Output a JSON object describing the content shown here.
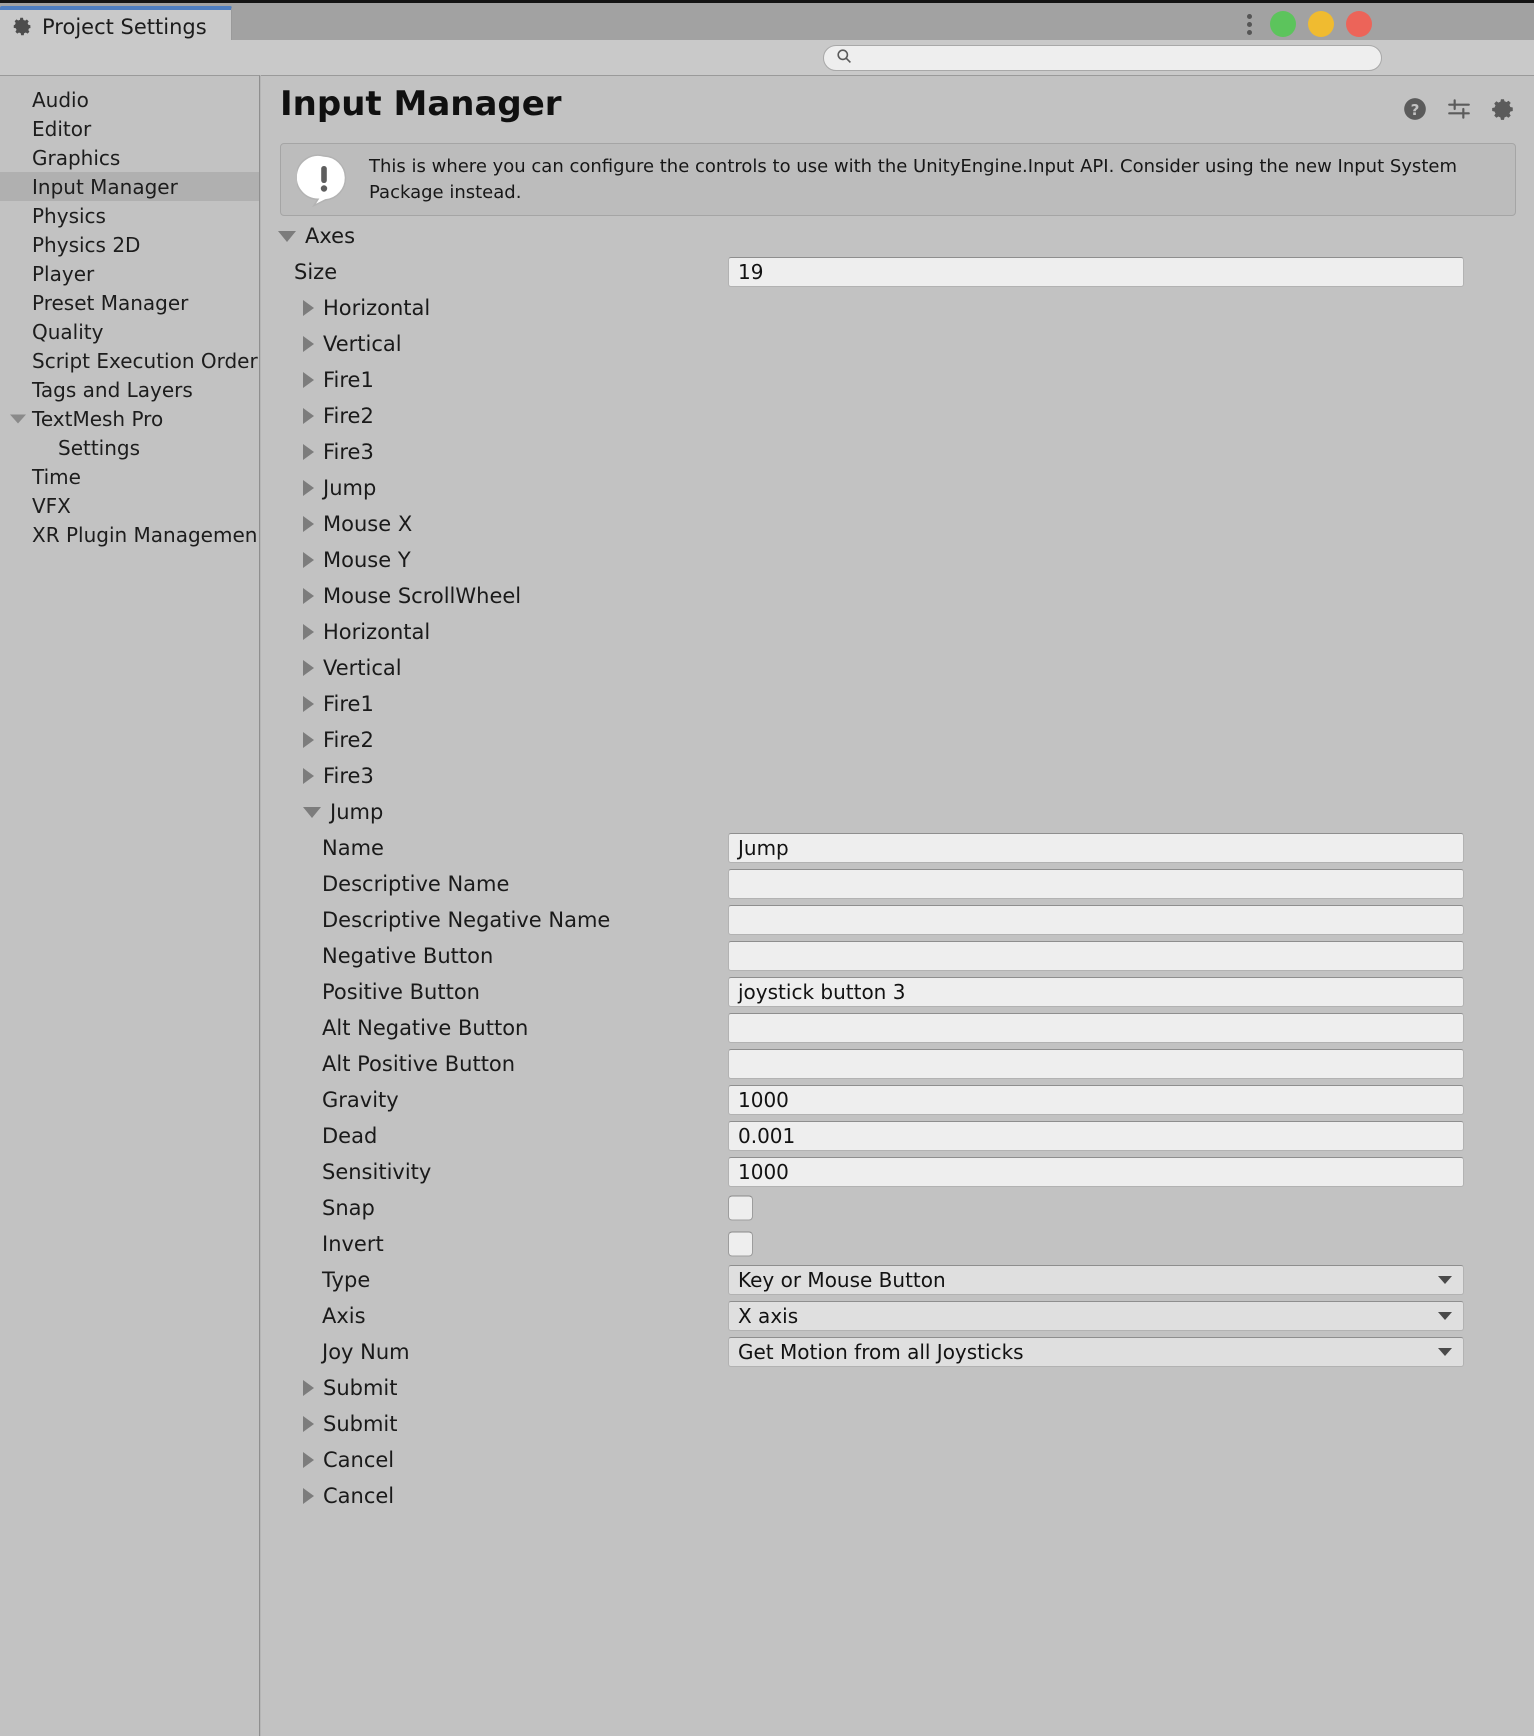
{
  "window": {
    "tab_label": "Project Settings",
    "tab_icon": "gear-icon",
    "menu_icon": "kebab-menu-icon",
    "buttons": {
      "minimize": "minimize-button",
      "maximize": "maximize-button",
      "close": "close-button"
    },
    "colors": {
      "minimize": "#5cc45c",
      "maximize": "#f0bb30",
      "close": "#ec6459",
      "tab_accent": "#4e7ec1"
    }
  },
  "search": {
    "value": "",
    "placeholder": "",
    "icon": "search-icon"
  },
  "sidebar": {
    "items": [
      {
        "label": "Audio",
        "level": 0,
        "selected": false,
        "expander": ""
      },
      {
        "label": "Editor",
        "level": 0,
        "selected": false,
        "expander": ""
      },
      {
        "label": "Graphics",
        "level": 0,
        "selected": false,
        "expander": ""
      },
      {
        "label": "Input Manager",
        "level": 0,
        "selected": true,
        "expander": ""
      },
      {
        "label": "Physics",
        "level": 0,
        "selected": false,
        "expander": ""
      },
      {
        "label": "Physics 2D",
        "level": 0,
        "selected": false,
        "expander": ""
      },
      {
        "label": "Player",
        "level": 0,
        "selected": false,
        "expander": ""
      },
      {
        "label": "Preset Manager",
        "level": 0,
        "selected": false,
        "expander": ""
      },
      {
        "label": "Quality",
        "level": 0,
        "selected": false,
        "expander": ""
      },
      {
        "label": "Script Execution Order",
        "level": 0,
        "selected": false,
        "expander": ""
      },
      {
        "label": "Tags and Layers",
        "level": 0,
        "selected": false,
        "expander": ""
      },
      {
        "label": "TextMesh Pro",
        "level": 0,
        "selected": false,
        "expander": "expanded"
      },
      {
        "label": "Settings",
        "level": 1,
        "selected": false,
        "expander": ""
      },
      {
        "label": "Time",
        "level": 0,
        "selected": false,
        "expander": ""
      },
      {
        "label": "VFX",
        "level": 0,
        "selected": false,
        "expander": ""
      },
      {
        "label": "XR Plugin Managemen",
        "level": 0,
        "selected": false,
        "expander": ""
      }
    ]
  },
  "main": {
    "title": "Input Manager",
    "header_icons": [
      {
        "name": "help-icon"
      },
      {
        "name": "preset-icon"
      },
      {
        "name": "settings-gear-icon"
      }
    ],
    "info": {
      "icon": "info-bubble-icon",
      "text": "This is where you can configure the controls to use with the UnityEngine.Input API. Consider using the new Input System Package instead."
    },
    "rows": [
      {
        "kind": "tree",
        "label": "Axes",
        "level": 0,
        "expander": "expanded"
      },
      {
        "kind": "text",
        "label": "Size",
        "level": 1,
        "value": "19"
      },
      {
        "kind": "tree",
        "label": "Horizontal",
        "level": 2,
        "expander": "collapsed"
      },
      {
        "kind": "tree",
        "label": "Vertical",
        "level": 2,
        "expander": "collapsed"
      },
      {
        "kind": "tree",
        "label": "Fire1",
        "level": 2,
        "expander": "collapsed"
      },
      {
        "kind": "tree",
        "label": "Fire2",
        "level": 2,
        "expander": "collapsed"
      },
      {
        "kind": "tree",
        "label": "Fire3",
        "level": 2,
        "expander": "collapsed"
      },
      {
        "kind": "tree",
        "label": "Jump",
        "level": 2,
        "expander": "collapsed"
      },
      {
        "kind": "tree",
        "label": "Mouse X",
        "level": 2,
        "expander": "collapsed"
      },
      {
        "kind": "tree",
        "label": "Mouse Y",
        "level": 2,
        "expander": "collapsed"
      },
      {
        "kind": "tree",
        "label": "Mouse ScrollWheel",
        "level": 2,
        "expander": "collapsed"
      },
      {
        "kind": "tree",
        "label": "Horizontal",
        "level": 2,
        "expander": "collapsed"
      },
      {
        "kind": "tree",
        "label": "Vertical",
        "level": 2,
        "expander": "collapsed"
      },
      {
        "kind": "tree",
        "label": "Fire1",
        "level": 2,
        "expander": "collapsed"
      },
      {
        "kind": "tree",
        "label": "Fire2",
        "level": 2,
        "expander": "collapsed"
      },
      {
        "kind": "tree",
        "label": "Fire3",
        "level": 2,
        "expander": "collapsed"
      },
      {
        "kind": "tree",
        "label": "Jump",
        "level": 2,
        "expander": "expanded"
      },
      {
        "kind": "text",
        "label": "Name",
        "level": 3,
        "value": "Jump"
      },
      {
        "kind": "text",
        "label": "Descriptive Name",
        "level": 3,
        "value": ""
      },
      {
        "kind": "text",
        "label": "Descriptive Negative Name",
        "level": 3,
        "value": ""
      },
      {
        "kind": "text",
        "label": "Negative Button",
        "level": 3,
        "value": ""
      },
      {
        "kind": "text",
        "label": "Positive Button",
        "level": 3,
        "value": "joystick button 3"
      },
      {
        "kind": "text",
        "label": "Alt Negative Button",
        "level": 3,
        "value": ""
      },
      {
        "kind": "text",
        "label": "Alt Positive Button",
        "level": 3,
        "value": ""
      },
      {
        "kind": "text",
        "label": "Gravity",
        "level": 3,
        "value": "1000"
      },
      {
        "kind": "text",
        "label": "Dead",
        "level": 3,
        "value": "0.001"
      },
      {
        "kind": "text",
        "label": "Sensitivity",
        "level": 3,
        "value": "1000"
      },
      {
        "kind": "checkbox",
        "label": "Snap",
        "level": 3,
        "checked": false
      },
      {
        "kind": "checkbox",
        "label": "Invert",
        "level": 3,
        "checked": false
      },
      {
        "kind": "dropdown",
        "label": "Type",
        "level": 3,
        "value": "Key or Mouse Button"
      },
      {
        "kind": "dropdown",
        "label": "Axis",
        "level": 3,
        "value": "X axis"
      },
      {
        "kind": "dropdown",
        "label": "Joy Num",
        "level": 3,
        "value": "Get Motion from all Joysticks"
      },
      {
        "kind": "tree",
        "label": "Submit",
        "level": 2,
        "expander": "collapsed"
      },
      {
        "kind": "tree",
        "label": "Submit",
        "level": 2,
        "expander": "collapsed"
      },
      {
        "kind": "tree",
        "label": "Cancel",
        "level": 2,
        "expander": "collapsed"
      },
      {
        "kind": "tree",
        "label": "Cancel",
        "level": 2,
        "expander": "collapsed"
      }
    ]
  }
}
